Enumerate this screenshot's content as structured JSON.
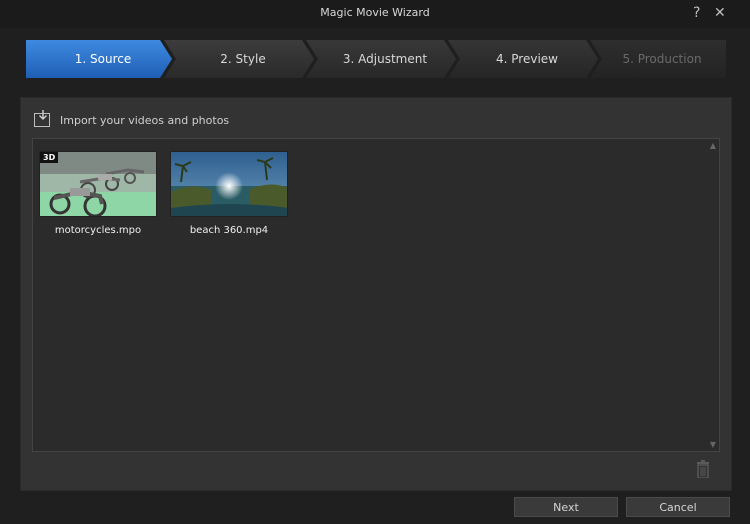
{
  "window": {
    "title": "Magic Movie Wizard",
    "help_glyph": "?",
    "close_glyph": "✕"
  },
  "steps": [
    {
      "label": "1. Source",
      "state": "active"
    },
    {
      "label": "2. Style",
      "state": "normal"
    },
    {
      "label": "3. Adjustment",
      "state": "normal"
    },
    {
      "label": "4. Preview",
      "state": "normal"
    },
    {
      "label": "5. Production",
      "state": "disabled"
    }
  ],
  "import": {
    "label": "Import your videos and photos",
    "icon": "import-icon"
  },
  "media": [
    {
      "name": "motorcycles.mpo",
      "badge": "3D"
    },
    {
      "name": "beach 360.mp4",
      "badge": ""
    }
  ],
  "footer": {
    "next_label": "Next",
    "cancel_label": "Cancel"
  },
  "colors": {
    "accent": "#2f74cf",
    "background": "#1f1f1f",
    "panel": "#333333"
  }
}
